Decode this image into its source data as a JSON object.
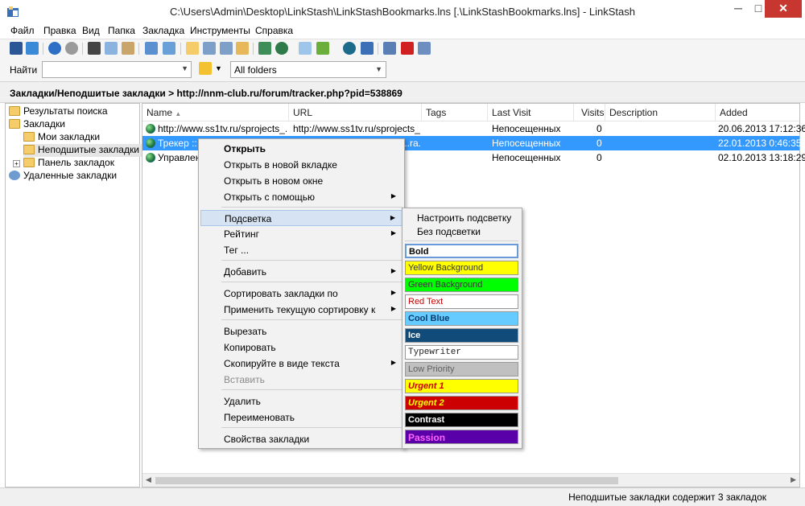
{
  "window": {
    "title": "C:\\Users\\Admin\\Desktop\\LinkStash\\LinkStashBookmarks.lns [.\\LinkStashBookmarks.lns] - LinkStash",
    "minimize": "─",
    "maximize": "□",
    "close": "✕"
  },
  "menu": [
    "Файл",
    "Правка",
    "Вид",
    "Папка",
    "Закладка",
    "Инструменты",
    "Справка"
  ],
  "find": {
    "label": "Найти",
    "value": "",
    "folder_value": "All folders",
    "arrow": "▼"
  },
  "path": "Закладки/Неподшитые закладки  >  http://nnm-club.ru/forum/tracker.php?pid=538869",
  "tree": [
    {
      "label": "Результаты поиска"
    },
    {
      "label": "Закладки"
    },
    {
      "label": "Мои закладки"
    },
    {
      "label": "Неподшитые закладки"
    },
    {
      "label": "Панель закладок"
    },
    {
      "label": "Удаленные закладки"
    }
  ],
  "columns": [
    "Name",
    "URL",
    "Tags",
    "Last Visit",
    "Visits",
    "Description",
    "Added"
  ],
  "rows": [
    {
      "name": "http://www.ss1tv.ru/sprojects_...",
      "url": "http://www.ss1tv.ru/sprojects_...",
      "tags": "",
      "last_visit": "Непосещенных",
      "visits": "0",
      "description": "",
      "added": "20.06.2013 17:12:36"
    },
    {
      "name": "Трекер :: Н",
      "url": "...ra...",
      "tags": "",
      "last_visit": "Непосещенных",
      "visits": "0",
      "description": "",
      "added": "22.01.2013 0:46:35"
    },
    {
      "name": "Управлен",
      "url": "",
      "tags": "",
      "last_visit": "Непосещенных",
      "visits": "0",
      "description": "",
      "added": "02.10.2013 13:18:29"
    }
  ],
  "context_menu": {
    "open": "Открыть",
    "open_new_tab": "Открыть в новой вкладке",
    "open_new_window": "Открыть в новом окне",
    "open_with": "Открыть с помощью",
    "highlight": "Подсветка",
    "rating": "Рейтинг",
    "tag": "Тег ...",
    "add": "Добавить",
    "sort_by": "Сортировать закладки по",
    "apply_sort": "Применить текущую сортировку к",
    "cut": "Вырезать",
    "copy": "Копировать",
    "copy_as_text": "Скопируйте в виде текста",
    "paste": "Вставить",
    "delete": "Удалить",
    "rename": "Переименовать",
    "properties": "Свойства закладки",
    "submenu_arrow": "▶"
  },
  "highlight_submenu": {
    "configure": "Настроить подсветку",
    "none": "Без подсветки",
    "options": [
      {
        "label": "Bold",
        "bg": "#ffffff",
        "fg": "#000000"
      },
      {
        "label": "Yellow Background",
        "bg": "#ffff00",
        "fg": "#333333"
      },
      {
        "label": "Green Background",
        "bg": "#00ff00",
        "fg": "#333333"
      },
      {
        "label": "Red Text",
        "bg": "#ffffff",
        "fg": "#cc0000"
      },
      {
        "label": "Cool Blue",
        "bg": "#66ccff",
        "fg": "#0a3c6e"
      },
      {
        "label": "Ice",
        "bg": "#114b7a",
        "fg": "#ffffff"
      },
      {
        "label": "Typewriter",
        "bg": "#ffffff",
        "fg": "#222222"
      },
      {
        "label": "Low Priority",
        "bg": "#c0c0c0",
        "fg": "#606060"
      },
      {
        "label": "Urgent 1",
        "bg": "#ffff00",
        "fg": "#cc0000"
      },
      {
        "label": "Urgent 2",
        "bg": "#cc0000",
        "fg": "#ffff00"
      },
      {
        "label": "Contrast",
        "bg": "#000000",
        "fg": "#ffffff"
      },
      {
        "label": "Passion",
        "bg": "#5a00a8",
        "fg": "#ff66ff"
      }
    ]
  },
  "status": "Неподшитые закладки содержит 3 закладок"
}
